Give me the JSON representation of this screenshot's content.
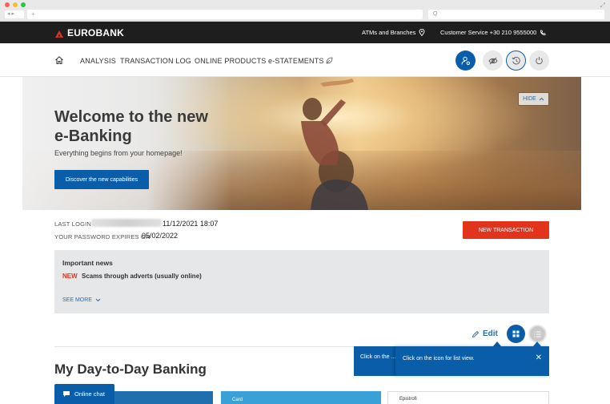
{
  "browser": {
    "tab_text": "+",
    "address_text": "Q"
  },
  "topbar": {
    "brand": "EUROBANK",
    "atms_label": "ATMs and Branches",
    "customer_service": "Customer Service +30 210 9555000"
  },
  "nav": {
    "items": [
      {
        "label": "ANALYSIS"
      },
      {
        "label": "TRANSACTION LOG"
      },
      {
        "label": "ONLINE PRODUCTS"
      },
      {
        "label": "e-STATEMENTS"
      }
    ]
  },
  "hero": {
    "title": "Welcome to the new e-Banking",
    "subtitle": "Everything begins from your homepage!",
    "button": "Discover the new capabilities",
    "hide_label": "HIDE"
  },
  "account": {
    "last_login_label": "LAST LOGIN",
    "last_login_value": "11/12/2021 18:07",
    "password_label": "YOUR PASSWORD EXPIRES ON",
    "password_value": "05/02/2022",
    "new_transaction": "NEW TRANSACTION"
  },
  "news": {
    "title": "Important news",
    "badge": "NEW",
    "headline": "Scams through adverts (usually online)",
    "see_more": "SEE MORE"
  },
  "toolbar": {
    "edit": "Edit"
  },
  "section": {
    "title": "My Day-to-Day Banking"
  },
  "tooltips": {
    "first": "Click on the ... of your prod...",
    "second": "Click on the icon for list view."
  },
  "cards": {
    "card_label": "Card",
    "third_label": "Epistrofi"
  },
  "chat": {
    "label": "Online chat"
  },
  "colors": {
    "brand_blue": "#0a5ea9",
    "accent_red": "#e2341d",
    "topbar": "#1e1e1e"
  }
}
